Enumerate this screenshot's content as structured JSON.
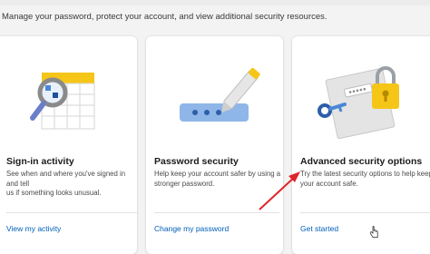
{
  "header": {
    "subtitle": "Manage your password, protect your account, and view additional security resources."
  },
  "cards": [
    {
      "title": "Sign-in activity",
      "desc_lines": [
        "See when and where you've signed in and tell",
        "us if something looks unusual."
      ],
      "link": "View my activity",
      "icon": "calendar-magnifier-icon"
    },
    {
      "title": "Password security",
      "desc_lines": [
        "Help keep your account safer by using a",
        "stronger password."
      ],
      "link": "Change my password",
      "icon": "password-field-pen-icon"
    },
    {
      "title": "Advanced security options",
      "desc_lines": [
        "Try the latest security options to help keep",
        "your account safe."
      ],
      "link": "Get started",
      "icon": "padlock-key-document-icon"
    }
  ],
  "colors": {
    "link": "#005fb8",
    "annotation_arrow": "#e0252b",
    "accent_yellow": "#f5c518",
    "accent_blue": "#4a86d6"
  }
}
